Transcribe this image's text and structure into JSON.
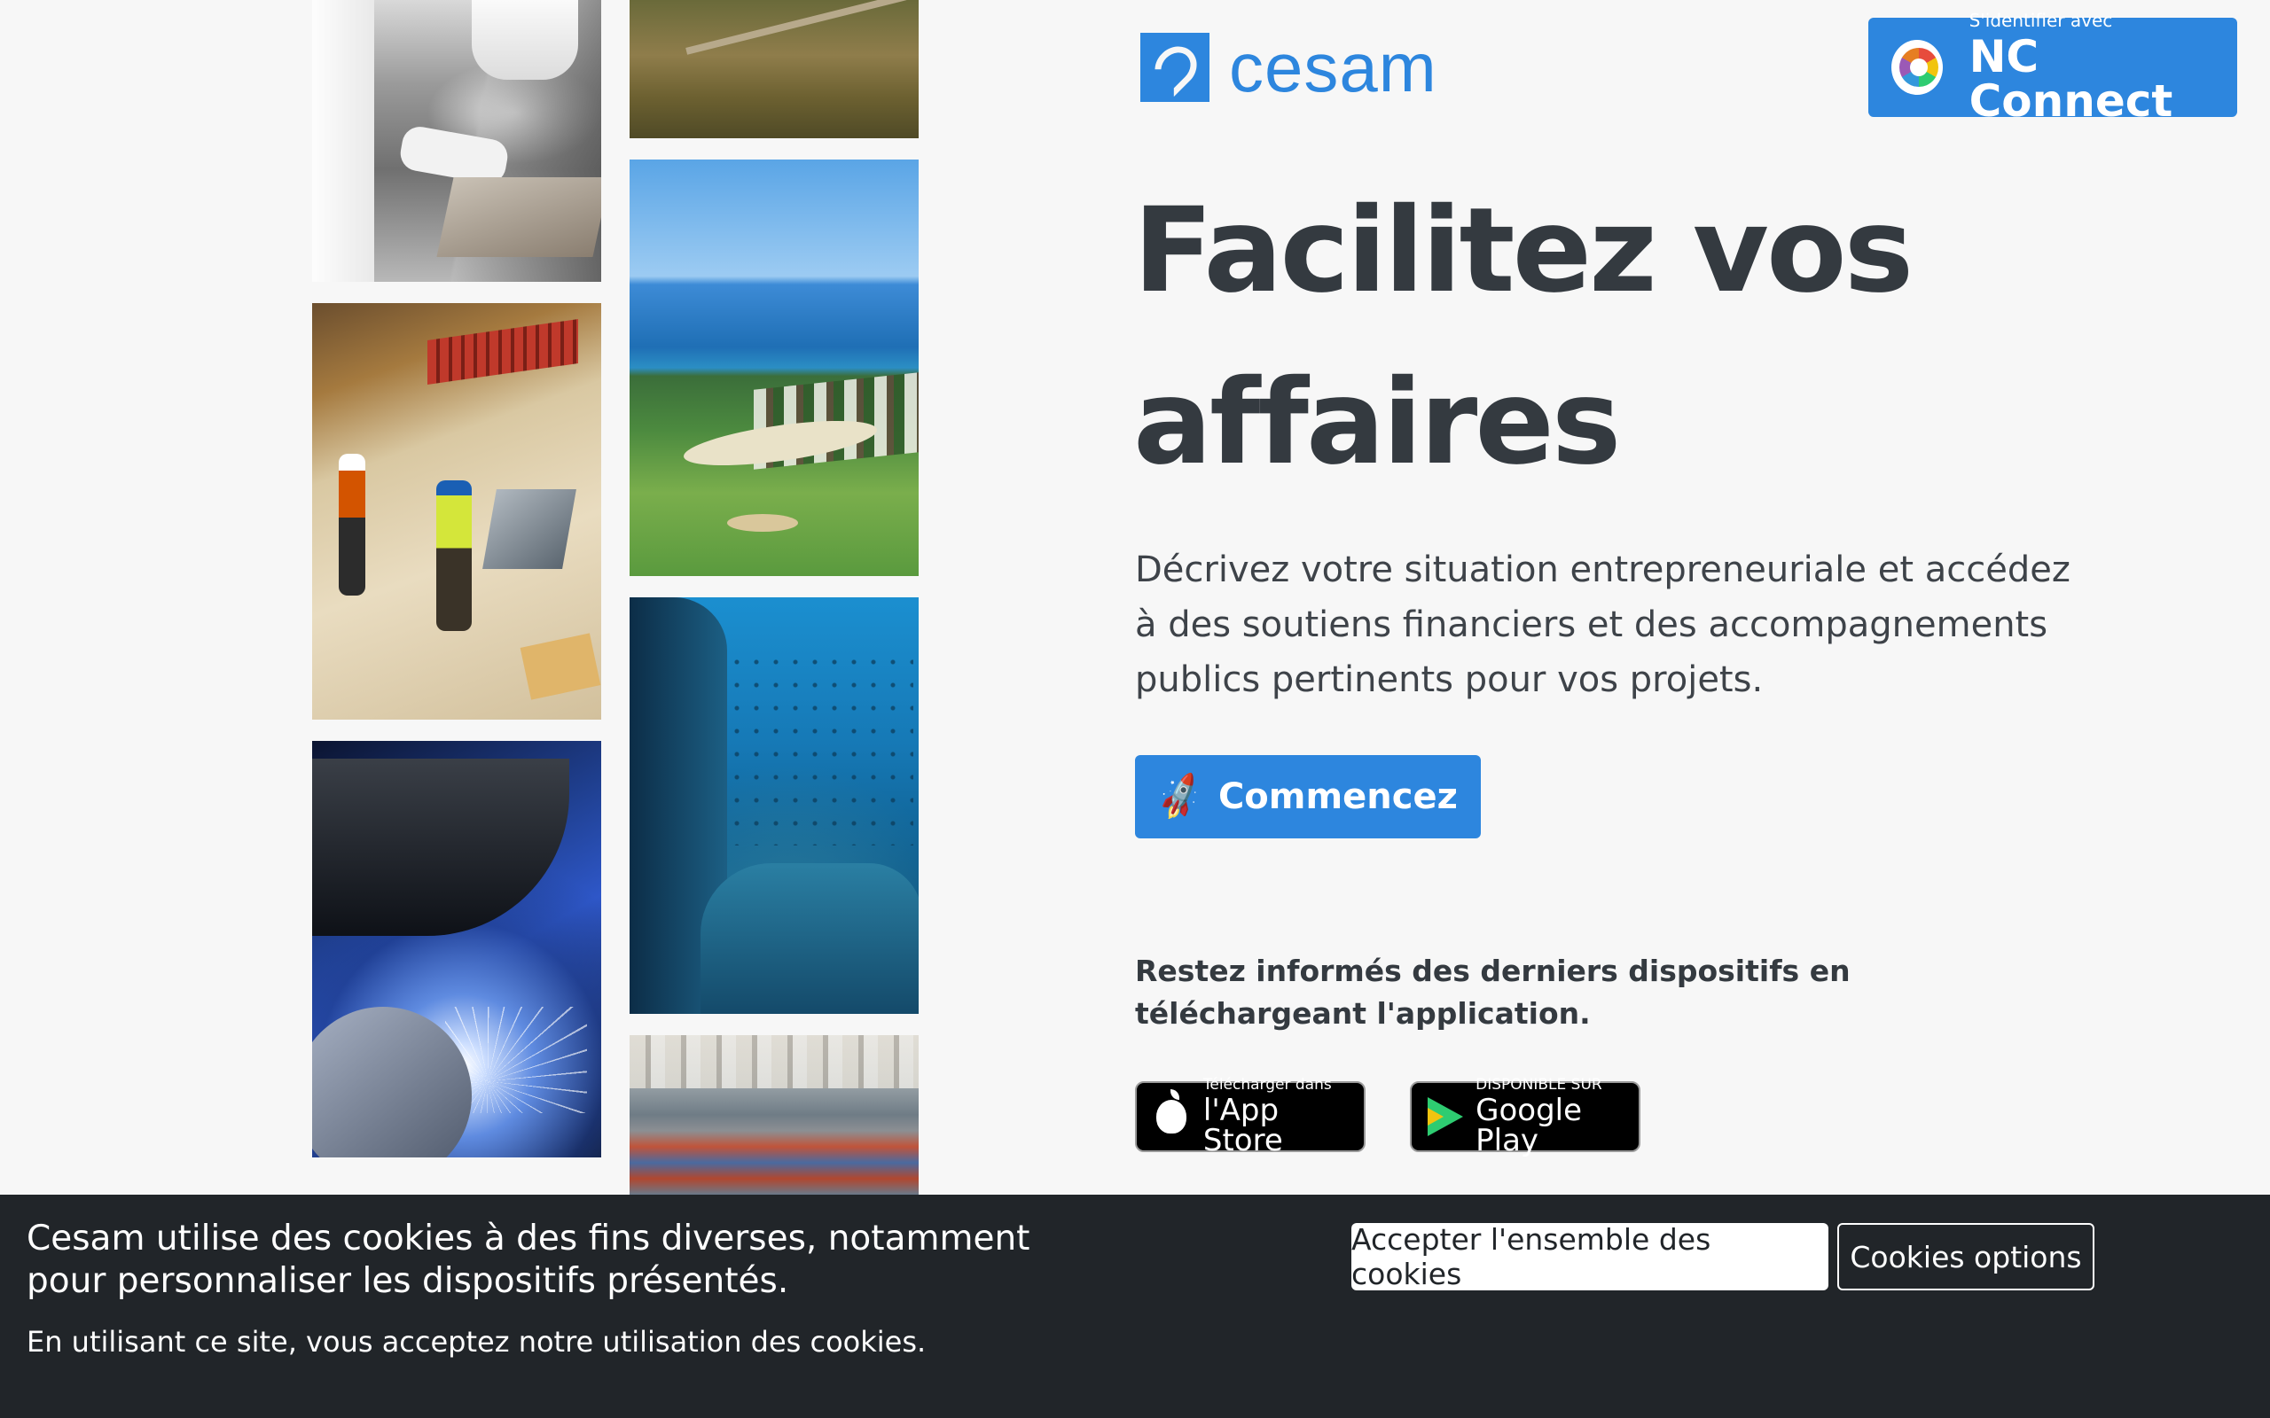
{
  "brand": {
    "name": "cesam",
    "logo_icon": "cesam-logo-icon",
    "accent_color": "#2d86de"
  },
  "nc_connect": {
    "small_label": "S'identifier avec",
    "big_label": "NC Connect",
    "icon": "nc-connect-icon"
  },
  "hero": {
    "title": "Facilitez vos affaires",
    "description": "Décrivez votre situation entrepreneuriale et accédez à des soutiens financiers et des accompagnements publics pertinents pour vos projets.",
    "cta_label": "Commencez",
    "cta_icon": "rocket-icon"
  },
  "app": {
    "note": "Restez informés des derniers dispositifs en téléchargeant l'application.",
    "app_store": {
      "small": "Télécharger dans",
      "big": "l'App Store",
      "icon": "apple-icon"
    },
    "google_play": {
      "small": "DISPONIBLE SUR",
      "big": "Google Play",
      "icon": "google-play-icon"
    }
  },
  "cookies": {
    "main_text": "Cesam utilise des cookies à des fins diverses, notamment pour personnaliser les dispositifs présentés.",
    "sub_text": "En utilisant ce site, vous acceptez notre utilisation des cookies.",
    "accept_label": "Accepter l'ensemble des cookies",
    "options_label": "Cookies options",
    "background": "#212529"
  }
}
